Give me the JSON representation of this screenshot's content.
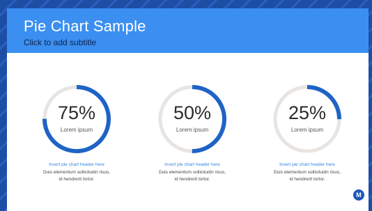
{
  "slide": {
    "title": "Pie Chart Sample",
    "subtitle": "Click to add subtitle"
  },
  "colors": {
    "header": "#3b8ff0",
    "arc": "#1f63c6",
    "track": "#e8e4e1",
    "background": "#1d4ea6"
  },
  "logo": {
    "icon": "motorola-logo-icon",
    "glyph": "M"
  },
  "chart_data": [
    {
      "type": "pie",
      "value": 75,
      "label": "75%",
      "sublabel": "Lorem ipsum",
      "header": "Insert pie chart header here",
      "body_lines": [
        "Duis elementum sollicitudin risus,",
        "id hendrerit tortor."
      ]
    },
    {
      "type": "pie",
      "value": 50,
      "label": "50%",
      "sublabel": "Lorem ipsum",
      "header": "Insert pie chart header here",
      "body_lines": [
        "Duis elementum sollicitudin risus,",
        "id hendrerit tortor."
      ]
    },
    {
      "type": "pie",
      "value": 25,
      "label": "25%",
      "sublabel": "Lorem ipsum",
      "header": "Insert pie chart header here",
      "body_lines": [
        "Duis elementum sollicitudin risus,",
        "id hendrerit tortor."
      ]
    }
  ]
}
